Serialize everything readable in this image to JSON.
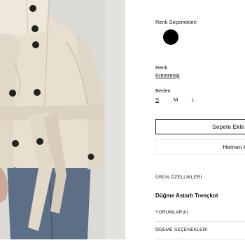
{
  "product": {
    "image_alt": "",
    "color_options_label": "Renk Seçenekleri",
    "swatch_color": "#000000",
    "color_label": "Renk",
    "color_value": "Kremrengi",
    "size_label": "Beden",
    "sizes": [
      "S",
      "M",
      "L"
    ],
    "selected_size": "S",
    "add_to_cart_label": "Sepete Ekle",
    "buy_now_label": "Hemen Al",
    "features_title": "ÜRÜN ÖZELLİKLERİ",
    "name": "Düğme Astarlı Trençkot",
    "reviews_label": "YORUMLAR(0)",
    "payment_label": "ÖDEME SEÇENEKLERİ"
  },
  "colors": {
    "coat": "#e6dccd",
    "belt": "#ddd2c1",
    "jeans": "#5d6f86",
    "background": "#d9d7d3",
    "button": "#222222"
  }
}
